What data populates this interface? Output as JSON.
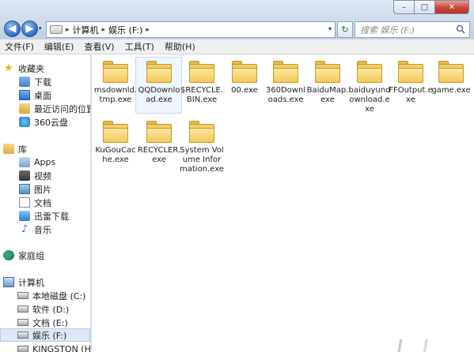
{
  "window": {
    "min_glyph": "–",
    "max_glyph": "□",
    "close_glyph": "✕"
  },
  "address": {
    "crumbs": [
      "计算机",
      "娱乐 (F:)"
    ],
    "separator": "▸",
    "dropdown": "▾"
  },
  "nav": {
    "back": "◀",
    "forward": "▶",
    "history": "▾",
    "refresh": "↻"
  },
  "search": {
    "placeholder": "搜索 娱乐 (F:)"
  },
  "menu": [
    "文件(F)",
    "编辑(E)",
    "查看(V)",
    "工具(T)",
    "帮助(H)"
  ],
  "sidebar": {
    "favorites": {
      "label": "收藏夹",
      "items": [
        "下载",
        "桌面",
        "最近访问的位置",
        "360云盘"
      ]
    },
    "libraries": {
      "label": "库",
      "items": [
        "Apps",
        "视频",
        "图片",
        "文档",
        "迅雷下载",
        "音乐"
      ]
    },
    "homegroup": {
      "label": "家庭组"
    },
    "computer": {
      "label": "计算机",
      "drives": [
        "本地磁盘 (C:)",
        "软件 (D:)",
        "文档 (E:)",
        "娱乐 (F:)",
        "KINGSTON (H:)"
      ],
      "selected_index": 3
    }
  },
  "content": {
    "items": [
      {
        "label": "msdownld.tmp.exe"
      },
      {
        "label": "QQDownload.exe",
        "selected": true
      },
      {
        "label": "$RECYCLE.BIN.exe"
      },
      {
        "label": "00.exe"
      },
      {
        "label": "360Downloads.exe"
      },
      {
        "label": "BaiduMap.exe"
      },
      {
        "label": "baiduyundownload.exe"
      },
      {
        "label": "FFOutput.exe"
      },
      {
        "label": "game.exe"
      },
      {
        "label": "KuGouCache.exe"
      },
      {
        "label": "RECYCLER.exe"
      },
      {
        "label": "System Volume Information.exe"
      }
    ]
  }
}
